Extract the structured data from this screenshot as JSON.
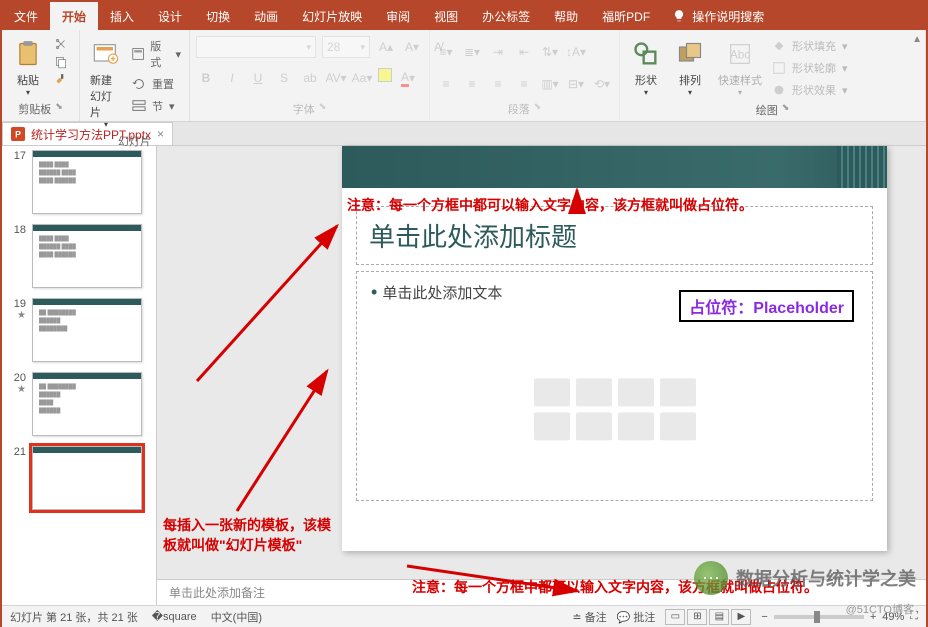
{
  "tabs": [
    "文件",
    "开始",
    "插入",
    "设计",
    "切换",
    "动画",
    "幻灯片放映",
    "审阅",
    "视图",
    "办公标签",
    "帮助",
    "福昕PDF"
  ],
  "active_tab": "开始",
  "tell_me": "操作说明搜索",
  "ribbon": {
    "clipboard": {
      "label": "剪贴板",
      "paste": "粘贴"
    },
    "slides": {
      "label": "幻灯片",
      "new": "新建\n幻灯片",
      "layout": "版式",
      "reset": "重置",
      "section": "节"
    },
    "font": {
      "label": "字体",
      "placeholder": "",
      "size": "28"
    },
    "paragraph": {
      "label": "段落"
    },
    "drawing": {
      "label": "绘图",
      "shapes": "形状",
      "arrange": "排列",
      "quick": "快速样式",
      "fill": "形状填充",
      "outline": "形状轮廓",
      "effects": "形状效果"
    }
  },
  "doc_tab": "统计学习方法PPT.pptx",
  "thumbs": [
    {
      "num": "17"
    },
    {
      "num": "18"
    },
    {
      "num": "19",
      "star": true
    },
    {
      "num": "20",
      "star": true
    },
    {
      "num": "21",
      "selected": true
    }
  ],
  "slide": {
    "title_ph": "单击此处添加标题",
    "body_ph": "单击此处添加文本",
    "ph_label": "占位符：Placeholder"
  },
  "annotations": {
    "top": "注意：每一个方框中都可以输入文字内容，该方框就叫做占位符。",
    "bottom": "注意：每一个方框中都可以输入文字内容，该方框就叫做占位符。",
    "left1": "每插入一张新的模板，该模",
    "left2": "板就叫做\"幻灯片模板\""
  },
  "notes": "单击此处添加备注",
  "status": {
    "left": "幻灯片 第 21 张，共 21 张",
    "lang": "中文(中国)",
    "notes": "备注",
    "comments": "批注",
    "zoom": "49%"
  },
  "watermark": "数据分析与统计学之美",
  "watermark_sub": "@51CTO博客"
}
